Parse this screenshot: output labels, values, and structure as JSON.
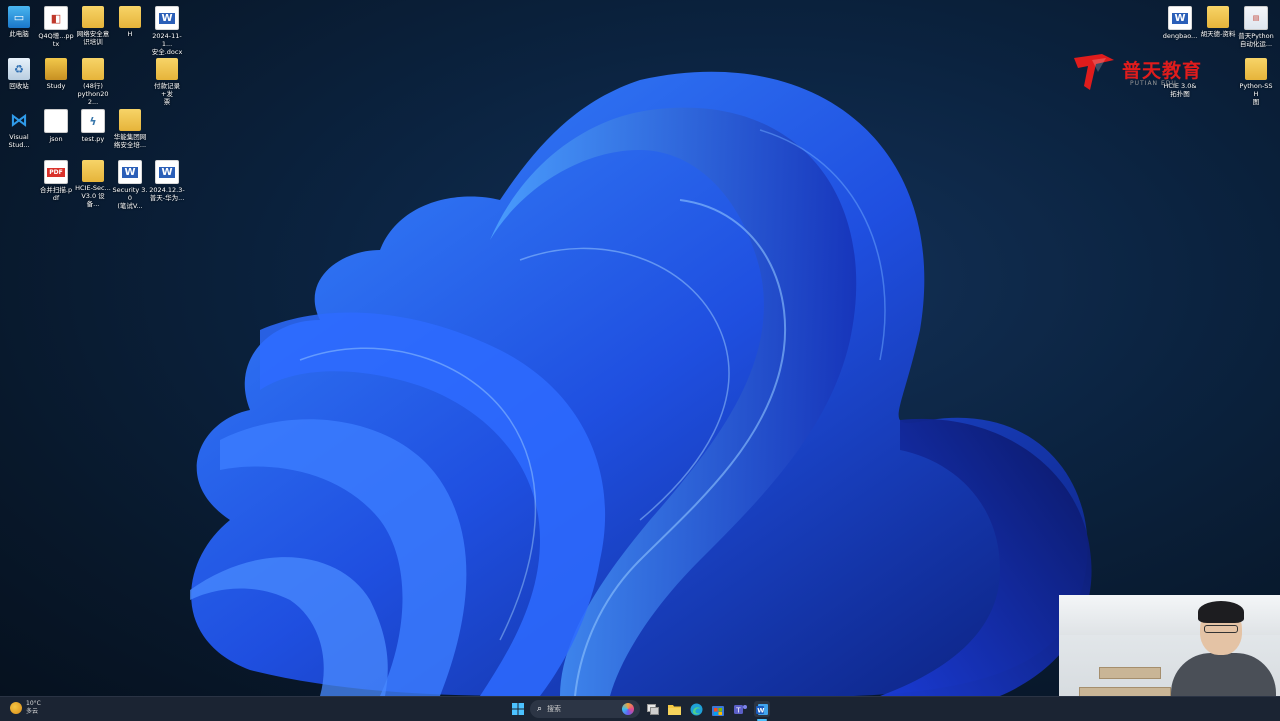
{
  "desktop_icons_left": [
    {
      "label": "此电脑",
      "icon": "computer-icon"
    },
    {
      "label": "Q4Q增...pptx",
      "icon": "pptx-icon"
    },
    {
      "label": "网络安全意\n识培训",
      "icon": "folder-icon"
    },
    {
      "label": "H",
      "icon": "folder-icon"
    },
    {
      "label": "2024-11-1...\n安全.docx",
      "icon": "word-icon"
    },
    {
      "label": "回收站",
      "icon": "recycle-bin-icon"
    },
    {
      "label": "Study",
      "icon": "folder-icon"
    },
    {
      "label": "(48行)\npython202...",
      "icon": "folder-icon"
    },
    {
      "label": "付款记录+发\n票",
      "icon": "folder-icon"
    },
    {
      "label": "Visual\nStud...",
      "icon": "vscode-icon"
    },
    {
      "label": "json",
      "icon": "file-icon"
    },
    {
      "label": "test.py",
      "icon": "python-icon"
    },
    {
      "label": "华能集团网\n络安全培...",
      "icon": "folder-icon"
    },
    {
      "label": "合并扫描.pdf",
      "icon": "pdf-icon"
    },
    {
      "label": "HCIE-Sec...\nV3.0 设备...",
      "icon": "folder-icon"
    },
    {
      "label": "Security 3.0\n(笔试V...",
      "icon": "word-icon"
    },
    {
      "label": "2024.12.3-\n普天-华为...",
      "icon": "word-icon"
    }
  ],
  "desktop_icons_right": [
    {
      "label": "dengbao...",
      "icon": "word-icon"
    },
    {
      "label": "胡天德-资料",
      "icon": "folder-icon"
    },
    {
      "label": "普天Python\n自动化运...",
      "icon": "image-icon"
    },
    {
      "label": "HCIE 3.0&\n拓扑图",
      "icon": "folder-icon"
    },
    {
      "label": "Python-SSH\n图",
      "icon": "folder-icon"
    }
  ],
  "logo": {
    "text": "普天教育",
    "sub": "PUTIAN EDU"
  },
  "weather": {
    "temp": "10°C",
    "desc": "多云"
  },
  "search": {
    "placeholder": "搜索"
  },
  "taskbar_icons": [
    "windows-start-icon",
    "search-box",
    "copilot-icon",
    "task-view-icon",
    "file-explorer-icon",
    "edge-icon",
    "store-icon",
    "teams-icon",
    "word-taskbar-icon"
  ]
}
